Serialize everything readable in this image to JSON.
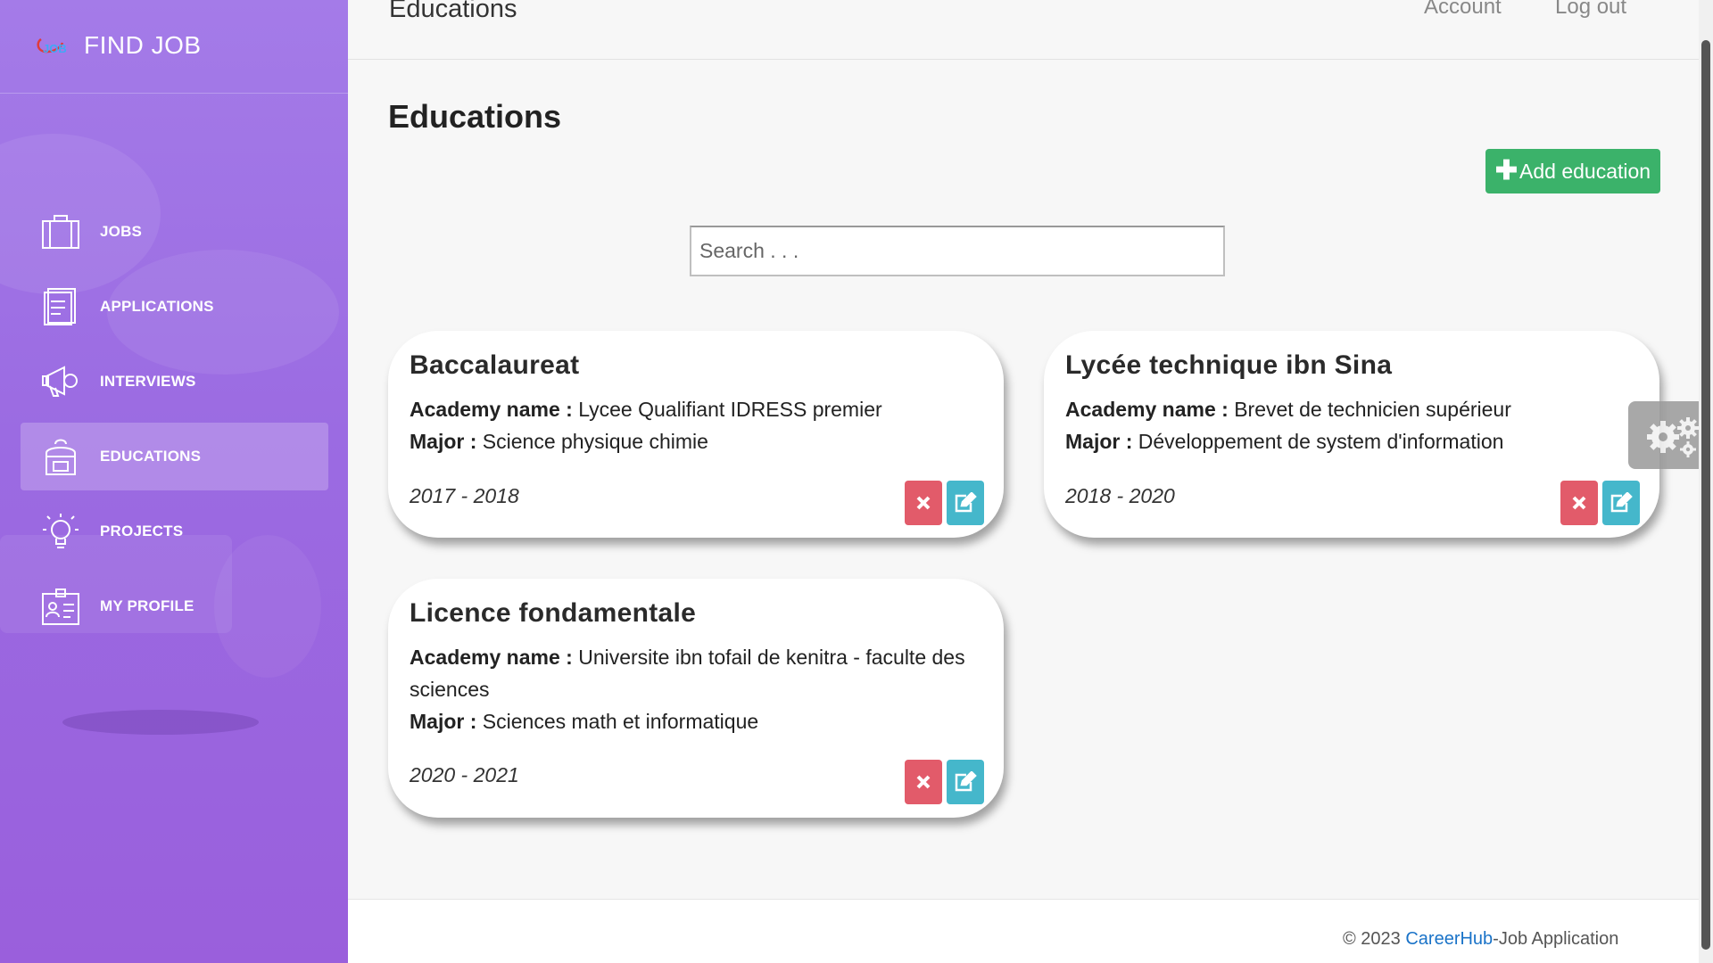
{
  "brand": {
    "name": "FIND JOB",
    "logo_text": "JOB"
  },
  "sidebar": {
    "items": [
      {
        "label": "JOBS",
        "icon": "briefcase-icon"
      },
      {
        "label": "APPLICATIONS",
        "icon": "document-icon"
      },
      {
        "label": "INTERVIEWS",
        "icon": "megaphone-icon"
      },
      {
        "label": "EDUCATIONS",
        "icon": "backpack-icon",
        "active": true
      },
      {
        "label": "PROJECTS",
        "icon": "lightbulb-icon"
      },
      {
        "label": "MY PROFILE",
        "icon": "id-card-icon"
      }
    ]
  },
  "topbar": {
    "title": "Educations",
    "account": "Account",
    "logout": "Log out"
  },
  "main": {
    "title": "Educations",
    "add_button": "Add education",
    "search_placeholder": "Search . . ."
  },
  "labels": {
    "academy": "Academy name :",
    "major": "Major :"
  },
  "educations": [
    {
      "title": "Baccalaureat",
      "academy": "Lycee Qualifiant IDRESS premier",
      "major": "Science physique chimie",
      "dates": "2017 - 2018"
    },
    {
      "title": "Lycée technique ibn Sina",
      "academy": "Brevet de technicien supérieur",
      "major": "Développement de system d'information",
      "dates": "2018 - 2020"
    },
    {
      "title": "Licence fondamentale",
      "academy": "Universite ibn tofail de kenitra - faculte des sciences",
      "major": "Sciences math et informatique",
      "dates": "2020 - 2021"
    }
  ],
  "footer": {
    "prefix": "© 2023 ",
    "link": "CareerHub",
    "suffix": "-Job Application"
  },
  "colors": {
    "sidebar": "#9b6be2",
    "add_button": "#3bb26a",
    "delete_button": "#e25b6a",
    "edit_button": "#45b7cb",
    "link": "#1a73c8"
  }
}
